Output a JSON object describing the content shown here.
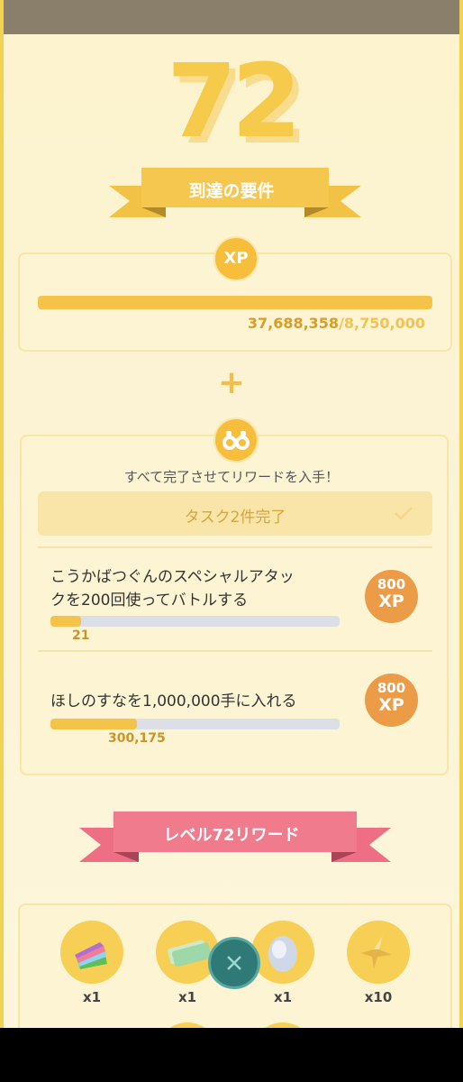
{
  "level": "72",
  "requirements_ribbon": "到達の要件",
  "xp_card": {
    "badge": "XP",
    "current": "37,688,358",
    "separator": "/",
    "goal": "8,750,000",
    "progress_fraction": 1.0
  },
  "plus_symbol": "+",
  "tasks_card": {
    "instruction": "すべて完了させてリワードを入手！",
    "completed_label": "タスク2件完了",
    "tasks": [
      {
        "title_line1": "こうかばつぐんのスペシャルアタッ",
        "title_line2": "クを200回使ってバトルする",
        "reward_amount": "800",
        "reward_unit": "XP",
        "progress_text": "21",
        "progress_fraction": 0.105
      },
      {
        "title_line1": "ほしのすなを1,000,000手に入れる",
        "reward_amount": "800",
        "reward_unit": "XP",
        "progress_text": "300,175",
        "progress_fraction": 0.3
      }
    ]
  },
  "rewards_ribbon": "レベル72リワード",
  "rewards": [
    {
      "icon": "rainbow-cake-icon",
      "count": "x1"
    },
    {
      "icon": "ticket-icon",
      "count": "x1"
    },
    {
      "icon": "egg-icon",
      "count": "x1"
    },
    {
      "icon": "star-piece-icon",
      "count": "x10"
    }
  ],
  "colors": {
    "accent_yellow": "#f5c24a",
    "reward_orange": "#ec9c46",
    "ribbon_pink": "#ee6f83",
    "close_teal": "#2f7a76"
  }
}
